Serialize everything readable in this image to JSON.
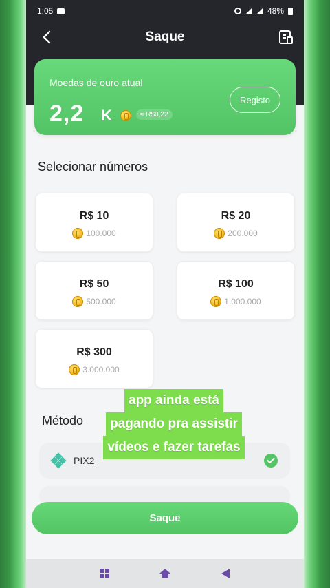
{
  "status_bar": {
    "time": "1:05",
    "battery": "48%"
  },
  "header": {
    "title": "Saque"
  },
  "balance_card": {
    "label": "Moedas de ouro atual",
    "amount": "2,2",
    "unit": "K",
    "approx": "≈ R$0,22",
    "registo_label": "Registo"
  },
  "select_title": "Selecionar números",
  "options": [
    {
      "price": "R$ 10",
      "coins": "100.000"
    },
    {
      "price": "R$ 20",
      "coins": "200.000"
    },
    {
      "price": "R$ 50",
      "coins": "500.000"
    },
    {
      "price": "R$ 100",
      "coins": "1.000.000"
    },
    {
      "price": "R$ 300",
      "coins": "3.000.000"
    }
  ],
  "method": {
    "title": "Método",
    "name": "PIX2"
  },
  "overlay_caption": [
    "app ainda está",
    "pagando pra assistir",
    "vídeos e fazer tarefas"
  ],
  "submit": {
    "label": "Saque"
  },
  "colors": {
    "accent": "#55c568",
    "dark_header": "#24262b",
    "caption_bg": "#7ddd4d"
  },
  "icons": [
    "back-arrow-icon",
    "document-icon",
    "coin-icon",
    "pix-icon",
    "check-icon",
    "grid-icon",
    "home-icon",
    "back-triangle-icon"
  ]
}
